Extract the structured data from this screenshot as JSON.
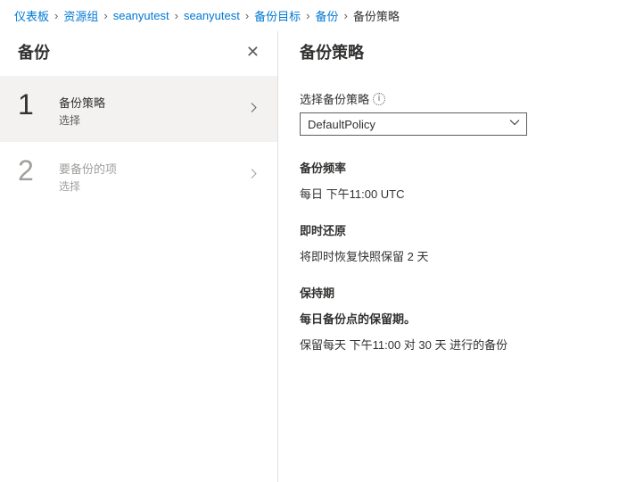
{
  "breadcrumb": {
    "items": [
      "仪表板",
      "资源组",
      "seanyutest",
      "seanyutest",
      "备份目标",
      "备份"
    ],
    "current": "备份策略"
  },
  "leftPanel": {
    "title": "备份",
    "steps": [
      {
        "num": "1",
        "title": "备份策略",
        "sub": "选择"
      },
      {
        "num": "2",
        "title": "要备份的项",
        "sub": "选择"
      }
    ]
  },
  "rightPanel": {
    "title": "备份策略",
    "policySelect": {
      "label": "选择备份策略",
      "value": "DefaultPolicy"
    },
    "frequency": {
      "title": "备份频率",
      "value": "每日 下午11:00 UTC"
    },
    "instant": {
      "title": "即时还原",
      "value": "将即时恢复快照保留 2 天"
    },
    "retention": {
      "title": "保持期",
      "dailyTitle": "每日备份点的保留期。",
      "dailyValue": "保留每天 下午11:00 对 30 天 进行的备份"
    }
  }
}
